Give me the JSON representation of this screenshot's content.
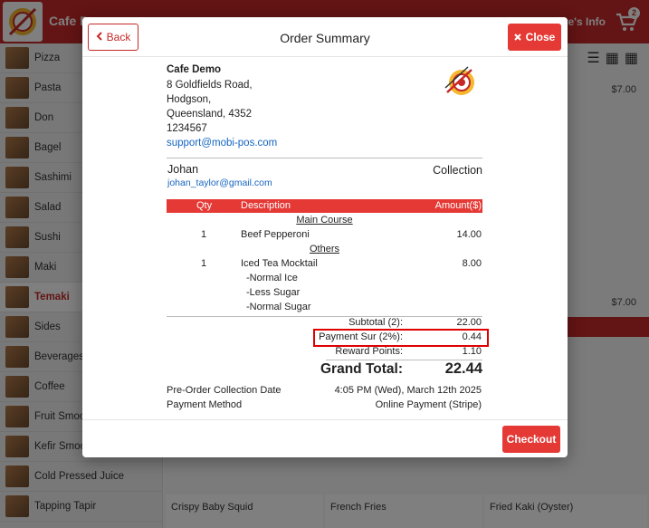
{
  "app": {
    "title": "Cafe Demo",
    "store_info_label": "Store's Info",
    "cart_count": "2"
  },
  "sidebar": {
    "items": [
      {
        "label": "Pizza"
      },
      {
        "label": "Pasta"
      },
      {
        "label": "Don"
      },
      {
        "label": "Bagel"
      },
      {
        "label": "Sashimi"
      },
      {
        "label": "Salad"
      },
      {
        "label": "Sushi"
      },
      {
        "label": "Maki"
      },
      {
        "label": "Temaki",
        "active": true
      },
      {
        "label": "Sides"
      },
      {
        "label": "Beverages"
      },
      {
        "label": "Coffee"
      },
      {
        "label": "Fruit Smoothies"
      },
      {
        "label": "Kefir Smoothies"
      },
      {
        "label": "Cold Pressed Juice"
      },
      {
        "label": "Tapping Tapir"
      }
    ]
  },
  "background": {
    "price_top": "$7.00",
    "price_mid": "$7.00",
    "cards": [
      "Crispy Baby Squid",
      "French Fries",
      "Fried Kaki (Oyster)"
    ]
  },
  "modal": {
    "title": "Order Summary",
    "back_label": "Back",
    "close_label": "Close",
    "checkout_label": "Checkout",
    "store": {
      "name": "Cafe Demo",
      "address_line1": "8 Goldfields Road,",
      "address_line2": "Hodgson,",
      "address_line3": "Queensland, 4352",
      "phone": "1234567",
      "email": "support@mobi-pos.com"
    },
    "customer": {
      "name": "Johan",
      "email": "johan_taylor@gmail.com",
      "order_type": "Collection"
    },
    "table_headers": {
      "qty": "Qty",
      "description": "Description",
      "amount": "Amount($)"
    },
    "categories": {
      "main": "Main Course",
      "others": "Others"
    },
    "items": {
      "item1": {
        "qty": "1",
        "description": "Beef Pepperoni",
        "amount": "14.00"
      },
      "item2": {
        "qty": "1",
        "description": "Iced Tea Mocktail",
        "amount": "8.00",
        "modifiers": [
          "-Normal Ice",
          "-Less Sugar",
          "-Normal Sugar"
        ]
      }
    },
    "totals": {
      "subtotal_label": "Subtotal (2):",
      "subtotal_value": "22.00",
      "surcharge_label": "Payment Sur (2%):",
      "surcharge_value": "0.44",
      "reward_label": "Reward Points:",
      "reward_value": "1.10",
      "grand_label": "Grand Total:",
      "grand_value": "22.44"
    },
    "info": {
      "collection_label": "Pre-Order Collection Date",
      "collection_value": "4:05 PM (Wed), March 12th 2025",
      "payment_label": "Payment Method",
      "payment_value": "Online Payment (Stripe)"
    }
  },
  "colors": {
    "brand_red": "#c62828",
    "button_red": "#e53935",
    "link_blue": "#1565c0",
    "highlight_border": "#e00000"
  }
}
